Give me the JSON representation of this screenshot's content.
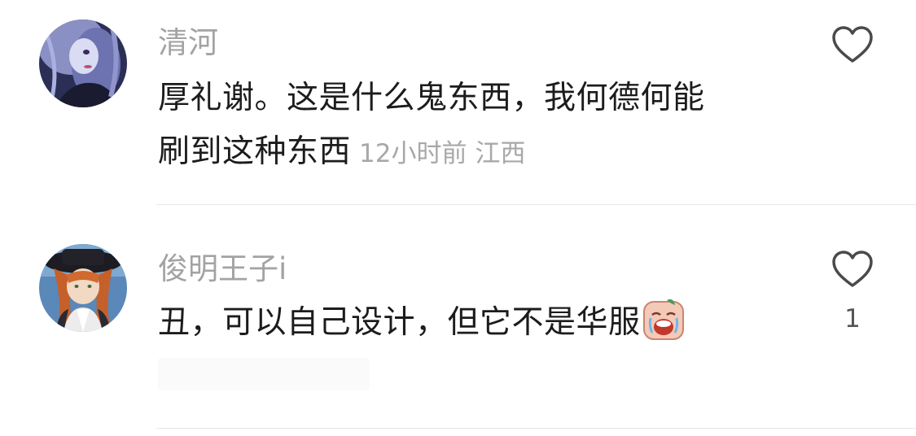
{
  "comments": [
    {
      "username": "清河",
      "text_line1": "厚礼谢。这是什么鬼东西，我何德何能",
      "text_line2": "刷到这种东西",
      "time": "12小时前",
      "location": "江西",
      "like_count": ""
    },
    {
      "username": "俊明王子i",
      "text": "丑，可以自己设计，但它不是华服",
      "like_count": "1"
    }
  ],
  "icons": {
    "like": "heart-outline-icon",
    "emoji": "crying-face-sticker"
  },
  "colors": {
    "username": "#a3a3a3",
    "body_text": "#1c1c1c",
    "meta": "#a8a8a8",
    "divider": "#e8e8e8",
    "heart_stroke": "#4a4a4a"
  }
}
